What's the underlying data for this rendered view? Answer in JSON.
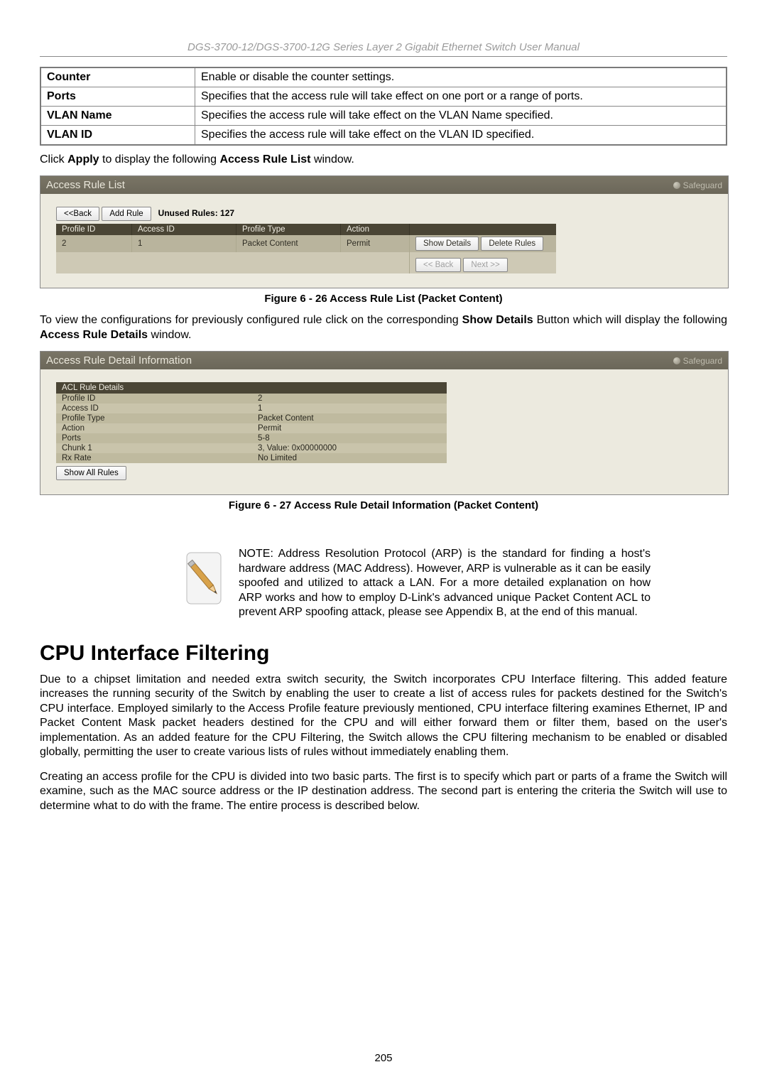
{
  "doc_header": "DGS-3700-12/DGS-3700-12G Series Layer 2 Gigabit Ethernet Switch User Manual",
  "param_table": {
    "rows": [
      {
        "label": "Counter",
        "desc": "Enable or disable the counter settings."
      },
      {
        "label": "Ports",
        "desc": "Specifies that the access rule will take effect on one port or a range of ports."
      },
      {
        "label": "VLAN Name",
        "desc": "Specifies the access rule will take effect on the VLAN Name specified."
      },
      {
        "label": "VLAN ID",
        "desc": "Specifies the access rule will take effect on the VLAN ID specified."
      }
    ]
  },
  "intro_line": {
    "pre": "Click ",
    "apply": "Apply",
    "mid": " to display the following ",
    "winname": "Access Rule List",
    "post": " window."
  },
  "arl": {
    "title": "Access Rule List",
    "safeguard": "Safeguard",
    "back": "<<Back",
    "add": "Add Rule",
    "unused": "Unused Rules: 127",
    "cols": {
      "pid": "Profile ID",
      "aid": "Access ID",
      "ptype": "Profile Type",
      "action": "Action"
    },
    "row": {
      "pid": "2",
      "aid": "1",
      "ptype": "Packet Content",
      "action": "Permit"
    },
    "show": "Show Details",
    "del": "Delete Rules",
    "prev": "<< Back",
    "next": "Next >>"
  },
  "caption1": "Figure 6 - 26 Access Rule List (Packet Content)",
  "para2": {
    "pre": "To view the configurations for previously configured rule click on the corresponding ",
    "btn": "Show Details",
    "mid": " Button which will display the following ",
    "win": "Access Rule Details",
    "post": " window."
  },
  "detail": {
    "title": "Access Rule Detail Information",
    "section": "ACL Rule Details",
    "rows": [
      {
        "k": "Profile  ID",
        "v": "2"
      },
      {
        "k": "Access ID",
        "v": "1"
      },
      {
        "k": "Profile Type",
        "v": "Packet Content"
      },
      {
        "k": "Action",
        "v": "Permit"
      },
      {
        "k": "Ports",
        "v": "5-8"
      },
      {
        "k": "Chunk 1",
        "v": "3, Value: 0x00000000"
      },
      {
        "k": "Rx Rate",
        "v": "No Limited"
      }
    ],
    "show_all": "Show All Rules"
  },
  "caption2": "Figure 6 - 27 Access Rule Detail Information (Packet Content)",
  "note": {
    "label": "NOTE:",
    "text": " Address Resolution Protocol (ARP) is the standard for finding a host's hardware address (MAC Address). However, ARP is vulnerable as it can be easily spoofed and utilized to attack a LAN. For a more detailed explanation on how ARP works and how to employ D-Link's advanced unique Packet Content ACL to prevent ARP spoofing attack, please see Appendix B, at the end of this manual."
  },
  "section_heading": "CPU Interface Filtering",
  "para3": "Due to a chipset limitation and needed extra switch security, the Switch incorporates CPU Interface filtering. This added feature increases the running security of the Switch by enabling the user to create a list of access rules for packets destined for the Switch's CPU interface. Employed similarly to the Access Profile feature previously mentioned, CPU interface filtering examines Ethernet, IP and Packet Content Mask packet headers destined for the CPU and will either forward them or filter them, based on the user's implementation. As an added feature for the CPU Filtering, the Switch allows the CPU filtering mechanism to be enabled or disabled globally, permitting the user to create various lists of rules without immediately enabling them.",
  "para4": "Creating an access profile for the CPU is divided into two basic parts. The first is to specify which part or parts of a frame the Switch will examine, such as the MAC source address or the IP destination address. The second part is entering the criteria the Switch will use to determine what to do with the frame. The entire process is described below.",
  "page_number": "205"
}
